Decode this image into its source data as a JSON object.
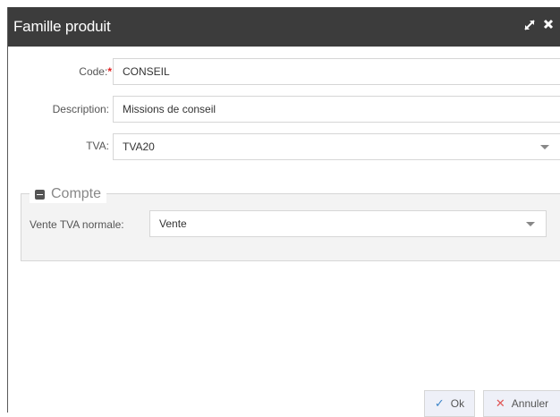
{
  "dialog": {
    "title": "Famille produit",
    "icons": {
      "maximize": "expand-icon",
      "close": "close-icon"
    }
  },
  "form": {
    "code": {
      "label": "Code:",
      "required_mark": "*",
      "value": "CONSEIL"
    },
    "description": {
      "label": "Description:",
      "value": "Missions de conseil"
    },
    "tva": {
      "label": "TVA:",
      "value": "TVA20"
    }
  },
  "compte": {
    "legend": "Compte",
    "vente": {
      "label": "Vente TVA normale:",
      "value": "Vente"
    }
  },
  "buttons": {
    "ok": "Ok",
    "cancel": "Annuler"
  },
  "colors": {
    "titlebar": "#3c3c3c",
    "required": "#e02020",
    "ok_icon": "#3f86c9",
    "cancel_icon": "#e05555",
    "button_bg": "#eef0f8"
  }
}
